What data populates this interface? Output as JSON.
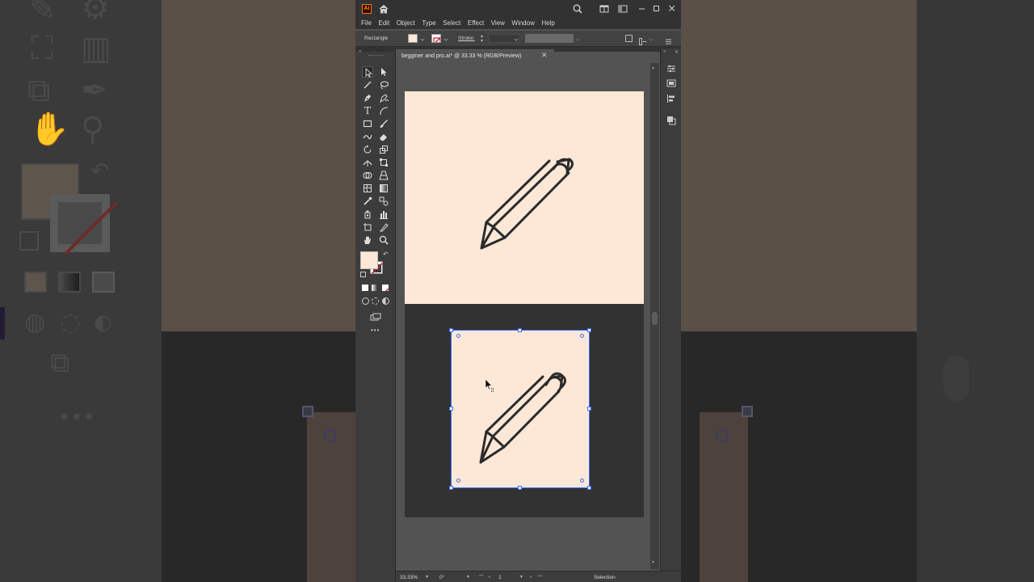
{
  "app": {
    "logo_text": "Ai",
    "menu": [
      "File",
      "Edit",
      "Object",
      "Type",
      "Select",
      "Effect",
      "View",
      "Window",
      "Help"
    ]
  },
  "control_bar": {
    "selection_type": "Rectangle",
    "stroke_label": "Stroke:"
  },
  "document": {
    "tab_title": "begginer and pro.ai* @ 33.33 % (RGB/Preview)",
    "close_glyph": "✕"
  },
  "status_bar": {
    "zoom": "33.33%",
    "rotation": "0°",
    "artboard_number": "1",
    "current_tool": "Selection"
  },
  "colors": {
    "artboard_fill": "#fde8d8",
    "artboard_dark": "#323232",
    "selection_blue": "#3a6dff",
    "icon_stroke": "#2b2b2b",
    "ui_dark": "#323232",
    "ui_panel": "#3c3c3c",
    "canvas_gray": "#535353"
  },
  "icons": {
    "artwork": "pencil-icon",
    "window_controls": [
      "minimize-icon",
      "maximize-icon",
      "close-icon"
    ]
  }
}
